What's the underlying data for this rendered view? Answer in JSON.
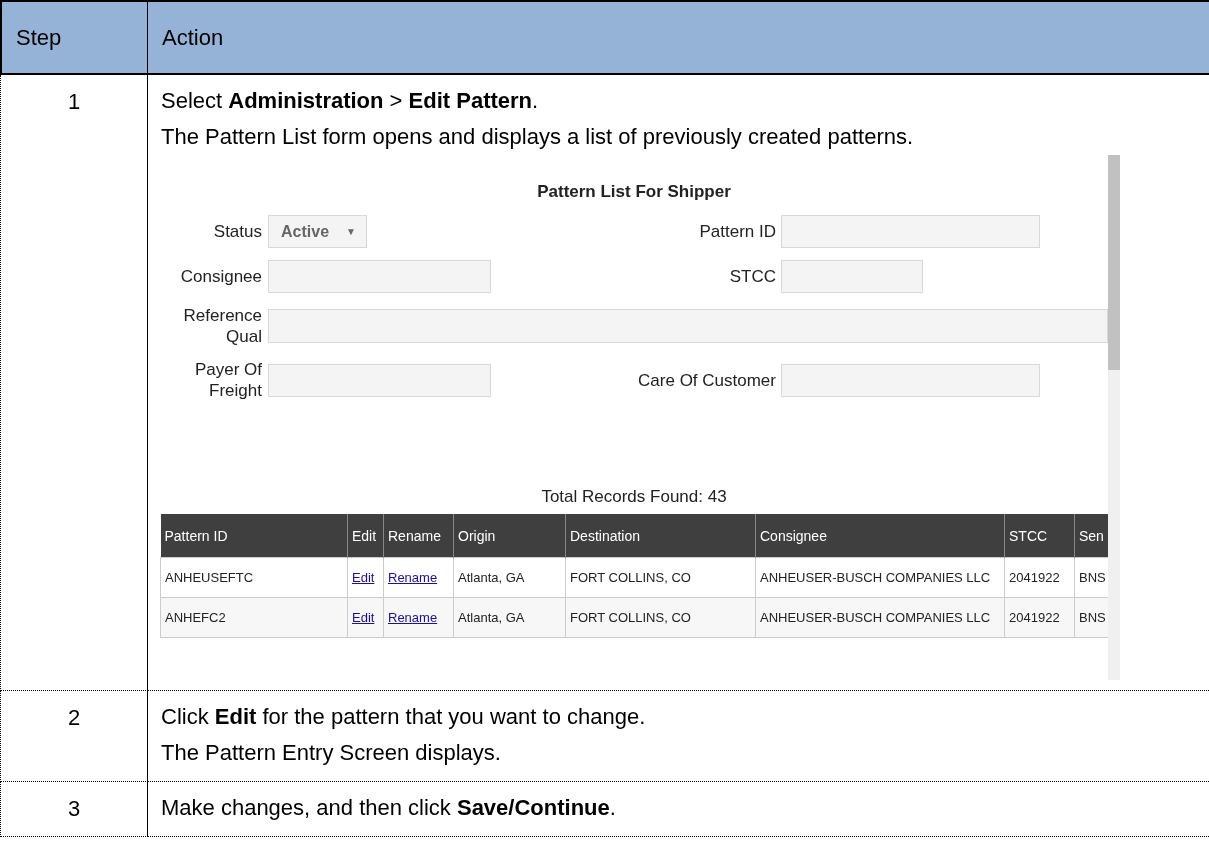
{
  "table": {
    "columns": [
      "Step",
      "Action"
    ],
    "rows": [
      {
        "step": "1",
        "lines": [
          "Select **Administration** > **Edit Pattern**.",
          "The Pattern List form opens and displays a list of previously created patterns."
        ],
        "screenshot": {
          "title": "Pattern List For Shipper",
          "filter_rows": [
            {
              "left": {
                "label": "Status",
                "kind": "select",
                "value": "Active",
                "caret": "▼"
              },
              "right": {
                "label": "Pattern ID",
                "kind": "field"
              }
            },
            {
              "left": {
                "label": "Consignee",
                "kind": "field"
              },
              "right": {
                "label": "STCC",
                "kind": "short-field"
              }
            },
            {
              "left": {
                "label": "Reference Qual",
                "kind": "wide-field"
              }
            },
            {
              "left": {
                "label": "Payer Of Freight",
                "kind": "field"
              },
              "right": {
                "label": "Care Of Customer",
                "kind": "field"
              }
            }
          ],
          "total": "Total Records Found: 43",
          "columns": [
            {
              "label": "Pattern ID",
              "kind": "text"
            },
            {
              "label": "Edit",
              "kind": "link"
            },
            {
              "label": "Rename",
              "kind": "link"
            },
            {
              "label": "Origin",
              "kind": "text"
            },
            {
              "label": "Destination",
              "kind": "text"
            },
            {
              "label": "Consignee",
              "kind": "text"
            },
            {
              "label": "STCC",
              "kind": "text"
            },
            {
              "label": "Sen",
              "kind": "text"
            }
          ],
          "rows": [
            {
              "cells": [
                "ANHEUSEFTC",
                "Edit",
                "Rename",
                "Atlanta, GA",
                "FORT COLLINS, CO",
                "ANHEUSER-BUSCH COMPANIES LLC",
                "2041922",
                "BNS"
              ]
            },
            {
              "cells": [
                "ANHEFC2",
                "Edit",
                "Rename",
                "Atlanta, GA",
                "FORT COLLINS, CO",
                "ANHEUSER-BUSCH COMPANIES LLC",
                "2041922",
                "BNS"
              ]
            }
          ]
        }
      },
      {
        "step": "2",
        "lines": [
          "Click **Edit** for the pattern that you want to change.",
          "The Pattern Entry Screen displays."
        ]
      },
      {
        "step": "3",
        "lines": [
          "Make changes, and then click **Save/Continue**."
        ]
      }
    ]
  }
}
